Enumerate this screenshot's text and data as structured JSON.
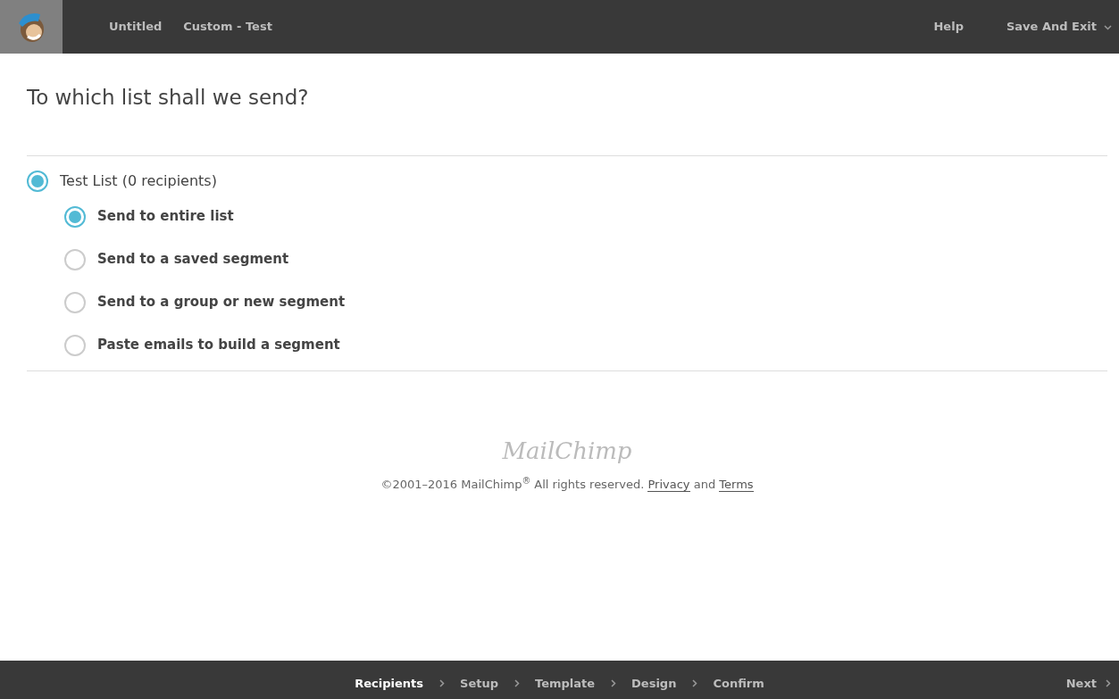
{
  "header": {
    "nav": [
      "Untitled",
      "Custom - Test"
    ],
    "help": "Help",
    "save": "Save And Exit"
  },
  "heading": "To which list shall we send?",
  "list": {
    "label": "Test List (0 recipients)",
    "selected": true
  },
  "options": [
    {
      "label": "Send to entire list",
      "selected": true
    },
    {
      "label": "Send to a saved segment",
      "selected": false
    },
    {
      "label": "Send to a group or new segment",
      "selected": false
    },
    {
      "label": "Paste emails to build a segment",
      "selected": false
    }
  ],
  "footer": {
    "wordmark": "MailChimp",
    "copyright": "©2001–2016 MailChimp$^{®}$ All rights reserved.",
    "privacy": "Privacy",
    "and": "and",
    "terms": "Terms"
  },
  "steps": [
    {
      "label": "Recipients",
      "selected": true
    },
    {
      "label": "Setup",
      "selected": false
    },
    {
      "label": "Template",
      "selected": false
    },
    {
      "label": "Design",
      "selected": false
    },
    {
      "label": "Confirm",
      "selected": false
    }
  ],
  "next": "Next"
}
